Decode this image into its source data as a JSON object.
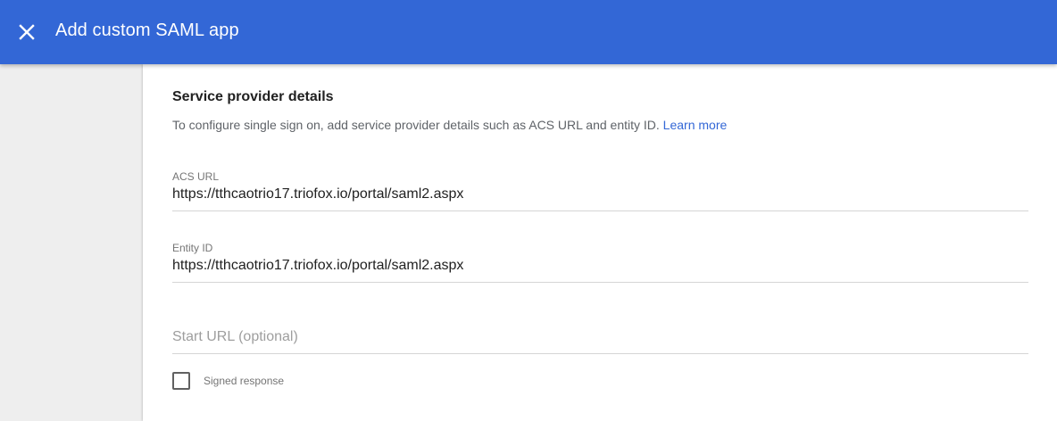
{
  "header": {
    "title": "Add custom SAML app",
    "close_icon": "close-icon"
  },
  "section": {
    "title": "Service provider details",
    "description": "To configure single sign on, add service provider details such as ACS URL and entity ID.",
    "learn_more": "Learn more"
  },
  "fields": {
    "acs_url": {
      "label": "ACS URL",
      "value": "https://tthcaotrio17.triofox.io/portal/saml2.aspx"
    },
    "entity_id": {
      "label": "Entity ID",
      "value": "https://tthcaotrio17.triofox.io/portal/saml2.aspx"
    },
    "start_url": {
      "placeholder": "Start URL (optional)",
      "value": ""
    }
  },
  "signed_response": {
    "label": "Signed response",
    "checked": false
  },
  "colors": {
    "header": "#3367d6",
    "link": "#3367d6",
    "background": "#eeeeee",
    "card": "#ffffff"
  }
}
